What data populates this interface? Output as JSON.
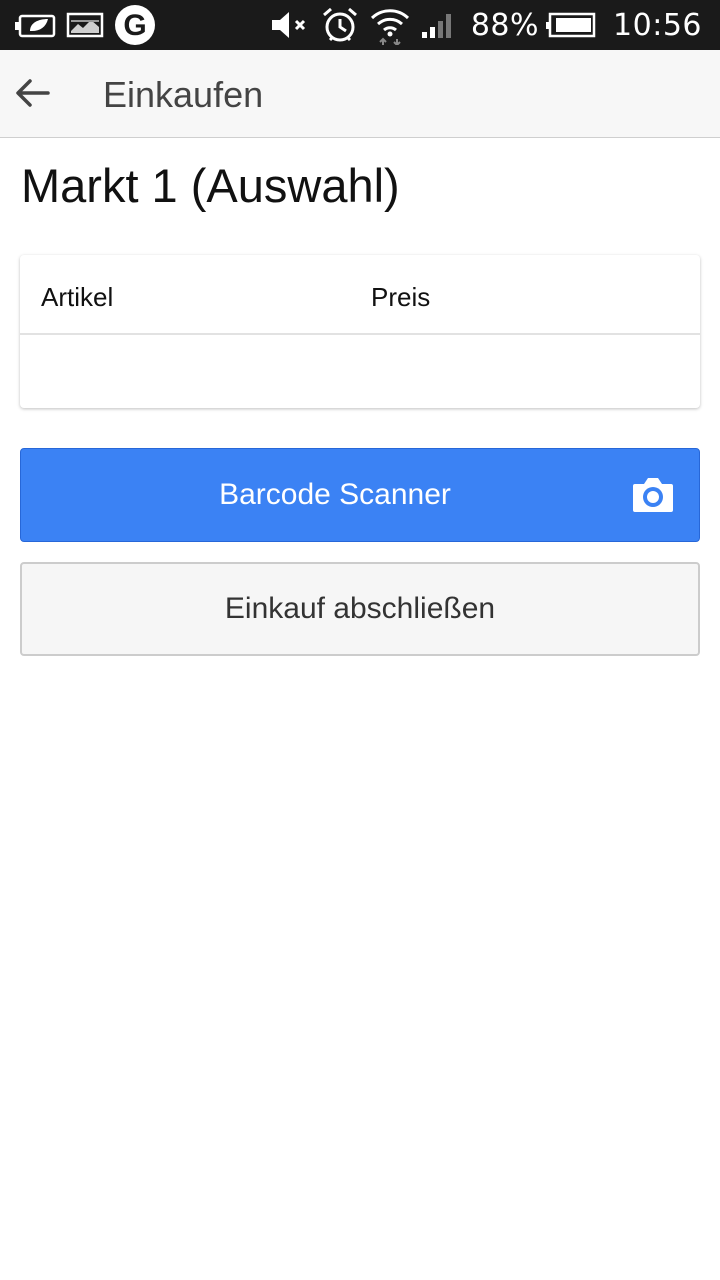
{
  "status_bar": {
    "battery_percent": "88%",
    "time": "10:56",
    "left_icons": [
      "battery-saver-icon",
      "gallery-icon",
      "g-logo-icon"
    ],
    "right_icons": [
      "mute-icon",
      "alarm-icon",
      "wifi-icon",
      "signal-icon",
      "battery-icon"
    ],
    "g_logo_letter": "G"
  },
  "app_bar": {
    "title": "Einkaufen",
    "back_icon": "arrow-left-icon"
  },
  "page": {
    "title": "Markt 1 (Auswahl)"
  },
  "table": {
    "columns": [
      "Artikel",
      "Preis"
    ],
    "rows": []
  },
  "buttons": {
    "scan_label": "Barcode Scanner",
    "scan_icon": "camera-icon",
    "finish_label": "Einkauf abschließen"
  },
  "colors": {
    "primary": "#3b82f4",
    "status_bar": "#1a1a1a",
    "app_bar": "#f7f7f7"
  }
}
